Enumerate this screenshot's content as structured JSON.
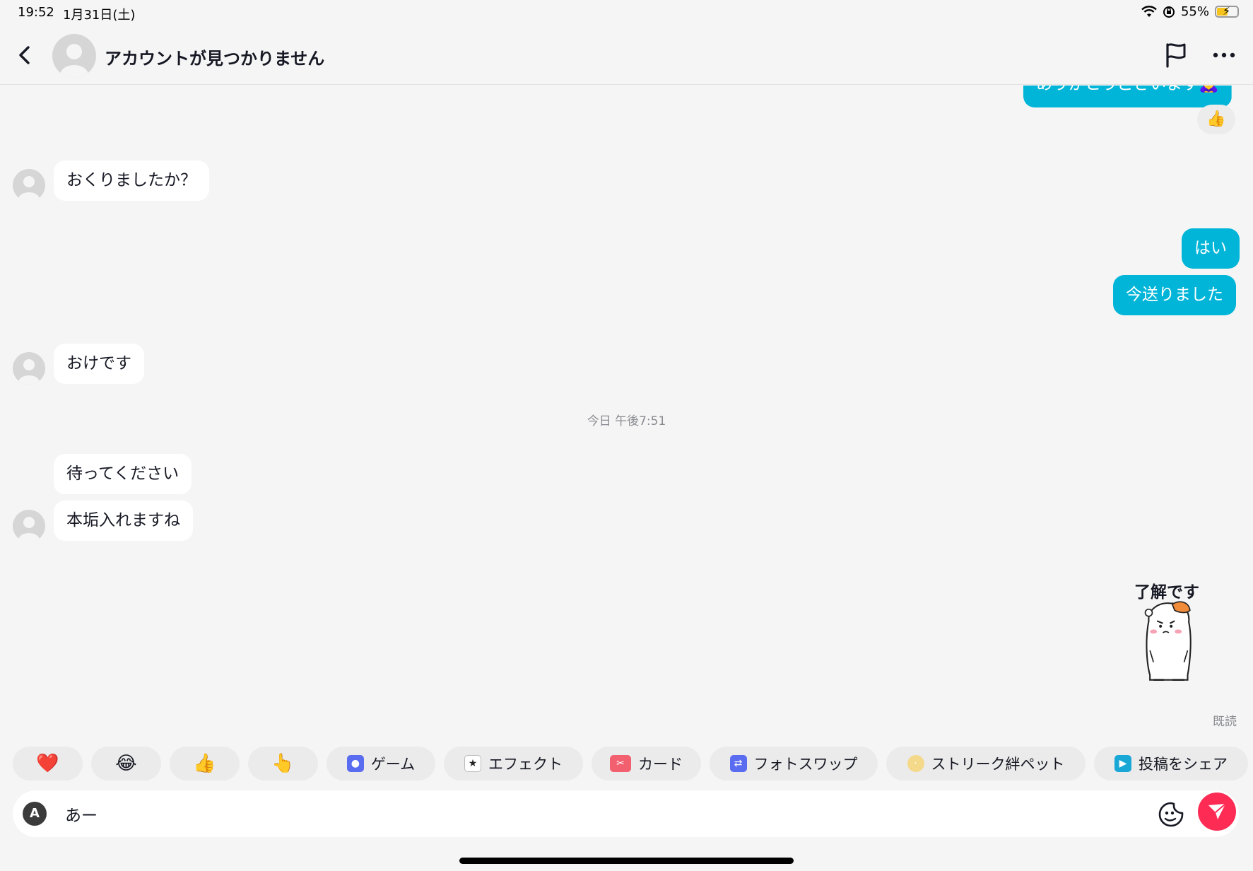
{
  "status_bar": {
    "time": "19:52",
    "date": "1月31日(土)",
    "battery": "55%",
    "battery_level": 0.55
  },
  "header": {
    "title": "アカウントが見つかりません"
  },
  "messages": {
    "top_out_partial": "ありがとうございます🙇‍♀️",
    "top_reaction": "👍",
    "in_1": "おくりましたか？",
    "out_1": "はい",
    "out_2": "今送りました",
    "in_2": "おけです",
    "timestamp": "今日 午後7:51",
    "in_3": "待ってください",
    "in_4": "本垢入れますね",
    "sticker_text": "了解です",
    "read_status": "既読"
  },
  "quick_actions": {
    "emoji_heart": "❤️",
    "emoji_laugh": "😂",
    "emoji_thumb": "👍",
    "emoji_point": "👆",
    "game": "ゲーム",
    "effect": "エフェクト",
    "card": "カード",
    "faceswap": "フォトスワップ",
    "streak_pet": "ストリーク絆ペット",
    "share_post": "投稿をシェア"
  },
  "input": {
    "value": "あー",
    "keyboard_label": "A"
  },
  "colors": {
    "outgoing_bubble": "#00b5d8",
    "send_button": "#fe2c55",
    "background": "#f5f5f5"
  }
}
